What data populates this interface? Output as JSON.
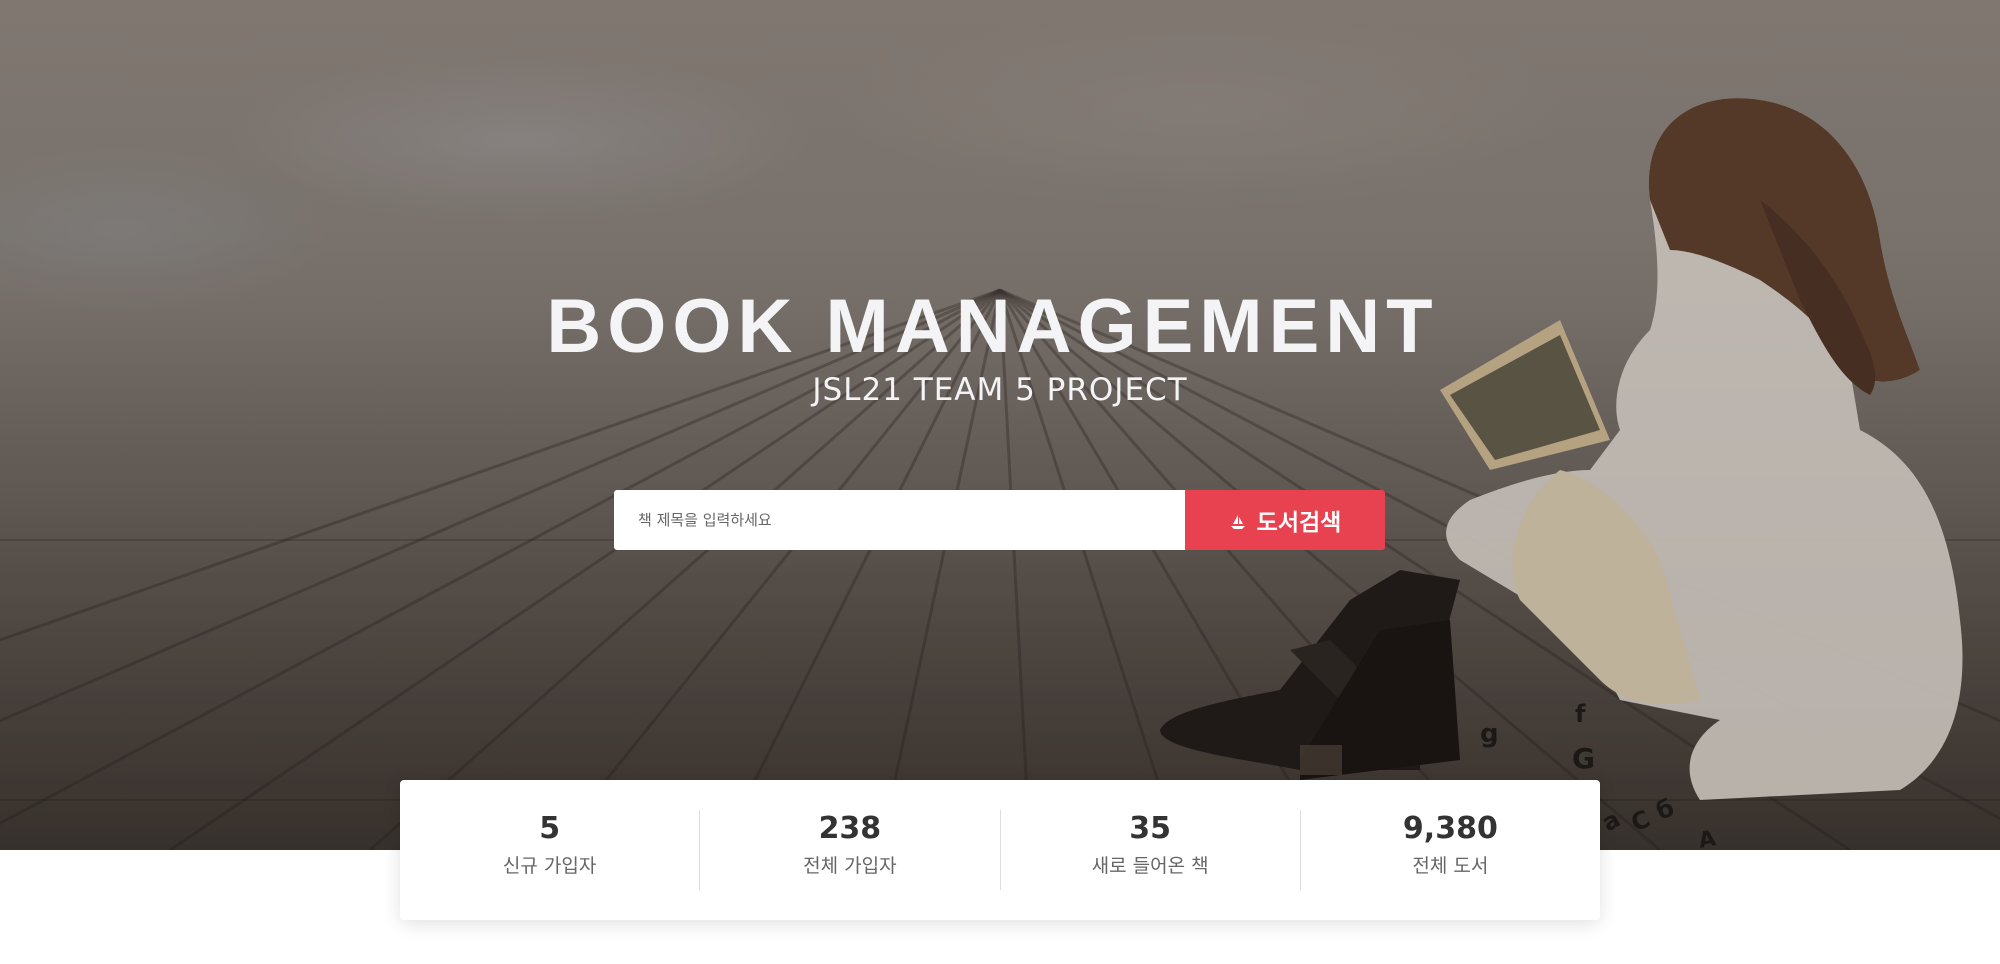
{
  "hero": {
    "title": "BOOK MANAGEMENT",
    "subtitle": "JSL21 TEAM 5 PROJECT"
  },
  "search": {
    "placeholder": "책 제목을 입력하세요",
    "button_label": "도서검색",
    "button_icon": "boat-icon"
  },
  "stats": [
    {
      "value": "5",
      "label": "신규 가입자"
    },
    {
      "value": "238",
      "label": "전체 가입자"
    },
    {
      "value": "35",
      "label": "새로 들어온 책"
    },
    {
      "value": "9,380",
      "label": "전체 도서"
    }
  ],
  "colors": {
    "accent": "#e84250",
    "hero_text": "#f4f4f6",
    "stat_number": "#333333",
    "stat_label": "#666666"
  }
}
